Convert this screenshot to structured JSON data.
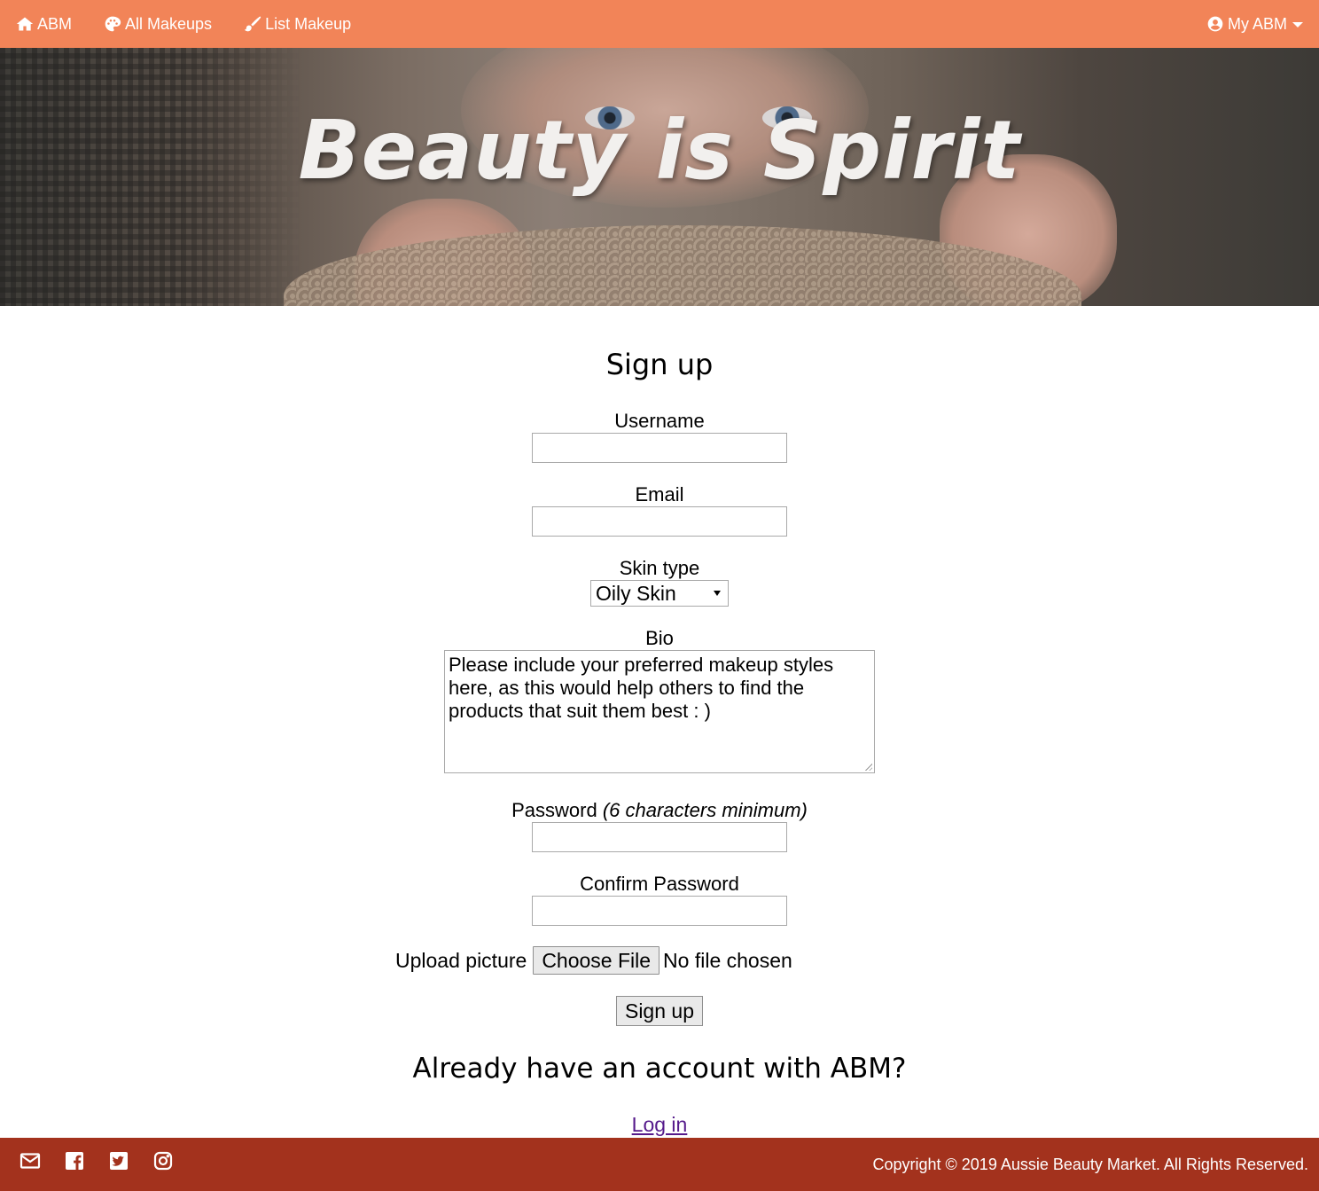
{
  "nav": {
    "home_label": "ABM",
    "all_makeups_label": "All Makeups",
    "list_makeup_label": "List Makeup",
    "account_label": "My ABM"
  },
  "hero": {
    "title": "Beauty is Spirit"
  },
  "form": {
    "heading": "Sign up",
    "username_label": "Username",
    "username_value": "",
    "email_label": "Email",
    "email_value": "",
    "skin_type_label": "Skin type",
    "skin_type_selected": "Oily Skin",
    "bio_label": "Bio",
    "bio_placeholder": "Please include your preferred makeup styles here, as this would help others to find the products that suit them best : )",
    "password_label": "Password",
    "password_hint": "(6 characters minimum)",
    "confirm_password_label": "Confirm Password",
    "upload_label": "Upload picture",
    "choose_file_label": "Choose File",
    "file_status": "No file chosen",
    "submit_label": "Sign up"
  },
  "login": {
    "heading": "Already have an account with ABM?",
    "link_label": "Log in"
  },
  "footer": {
    "icons": [
      "envelope-icon",
      "facebook-icon",
      "twitter-icon",
      "instagram-icon"
    ],
    "copyright": "Copyright © 2019 Aussie Beauty Market. All Rights Reserved."
  },
  "colors": {
    "navbar": "#f28458",
    "footer": "#a3321d",
    "link": "#551a8b"
  }
}
